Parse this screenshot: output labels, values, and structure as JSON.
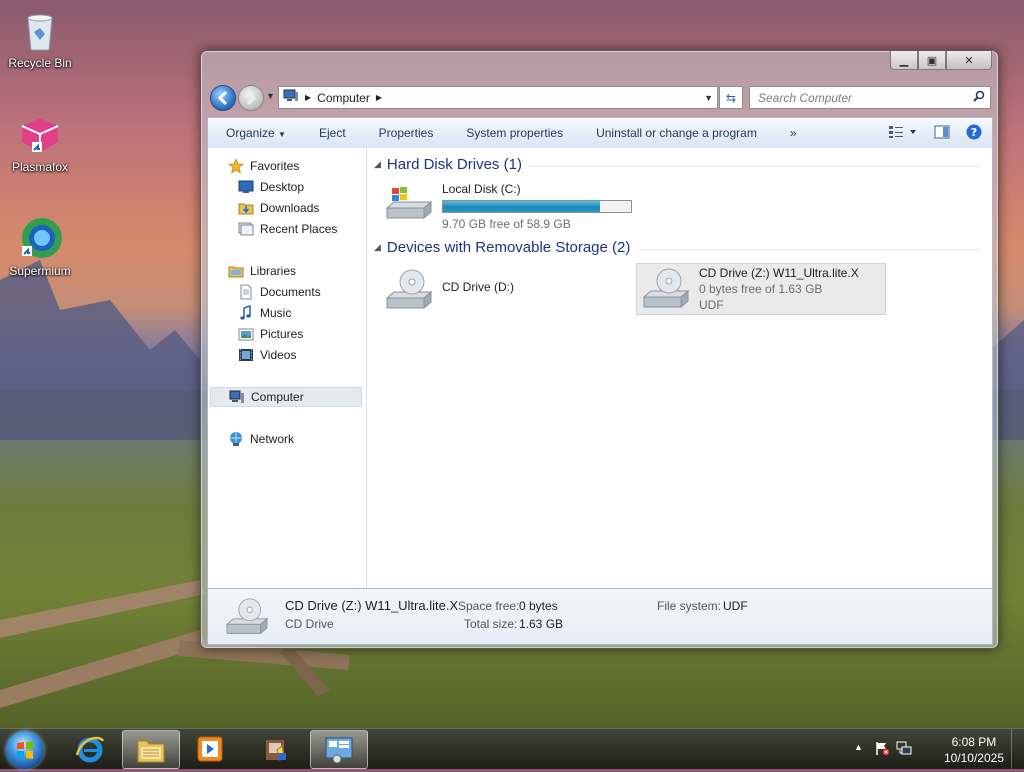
{
  "desktop": {
    "icons": [
      {
        "label": "Recycle Bin",
        "icon": "recycle-bin-icon"
      },
      {
        "label": "Plasmafox",
        "icon": "plasmafox-icon"
      },
      {
        "label": "Supermium",
        "icon": "supermium-icon"
      }
    ]
  },
  "window": {
    "caption": {
      "minimize": "minimize-icon",
      "maximize": "maximize-icon",
      "close": "close-icon"
    },
    "address": {
      "path": "Computer"
    },
    "search": {
      "placeholder": "Search Computer"
    },
    "toolbar": {
      "organize": "Organize",
      "eject": "Eject",
      "properties": "Properties",
      "system_properties": "System properties",
      "uninstall": "Uninstall or change a program",
      "more": "»"
    },
    "sidebar": {
      "favorites": "Favorites",
      "desktop": "Desktop",
      "downloads": "Downloads",
      "recent_places": "Recent Places",
      "libraries": "Libraries",
      "documents": "Documents",
      "music": "Music",
      "pictures": "Pictures",
      "videos": "Videos",
      "computer": "Computer",
      "network": "Network"
    },
    "groups": {
      "hdd": "Hard Disk Drives (1)",
      "removable": "Devices with Removable Storage (2)"
    },
    "drives": {
      "c": {
        "name": "Local Disk (C:)",
        "free": "9.70 GB free of 58.9 GB",
        "used_fraction": 0.835
      },
      "d": {
        "name": "CD Drive (D:)"
      },
      "z": {
        "name": "CD Drive (Z:) W11_Ultra.lite.X",
        "free": "0 bytes free of 1.63 GB",
        "fs": "UDF"
      }
    },
    "details": {
      "title": "CD Drive (Z:) W11_Ultra.lite.X",
      "type": "CD Drive",
      "space_free_label": "Space free:",
      "space_free": "0 bytes",
      "total_size_label": "Total size:",
      "total_size": "1.63 GB",
      "filesystem_label": "File system:",
      "filesystem": "UDF"
    }
  },
  "taskbar": {
    "time": "6:08 PM",
    "date": "10/10/2025",
    "tray_arrow": "▲"
  }
}
